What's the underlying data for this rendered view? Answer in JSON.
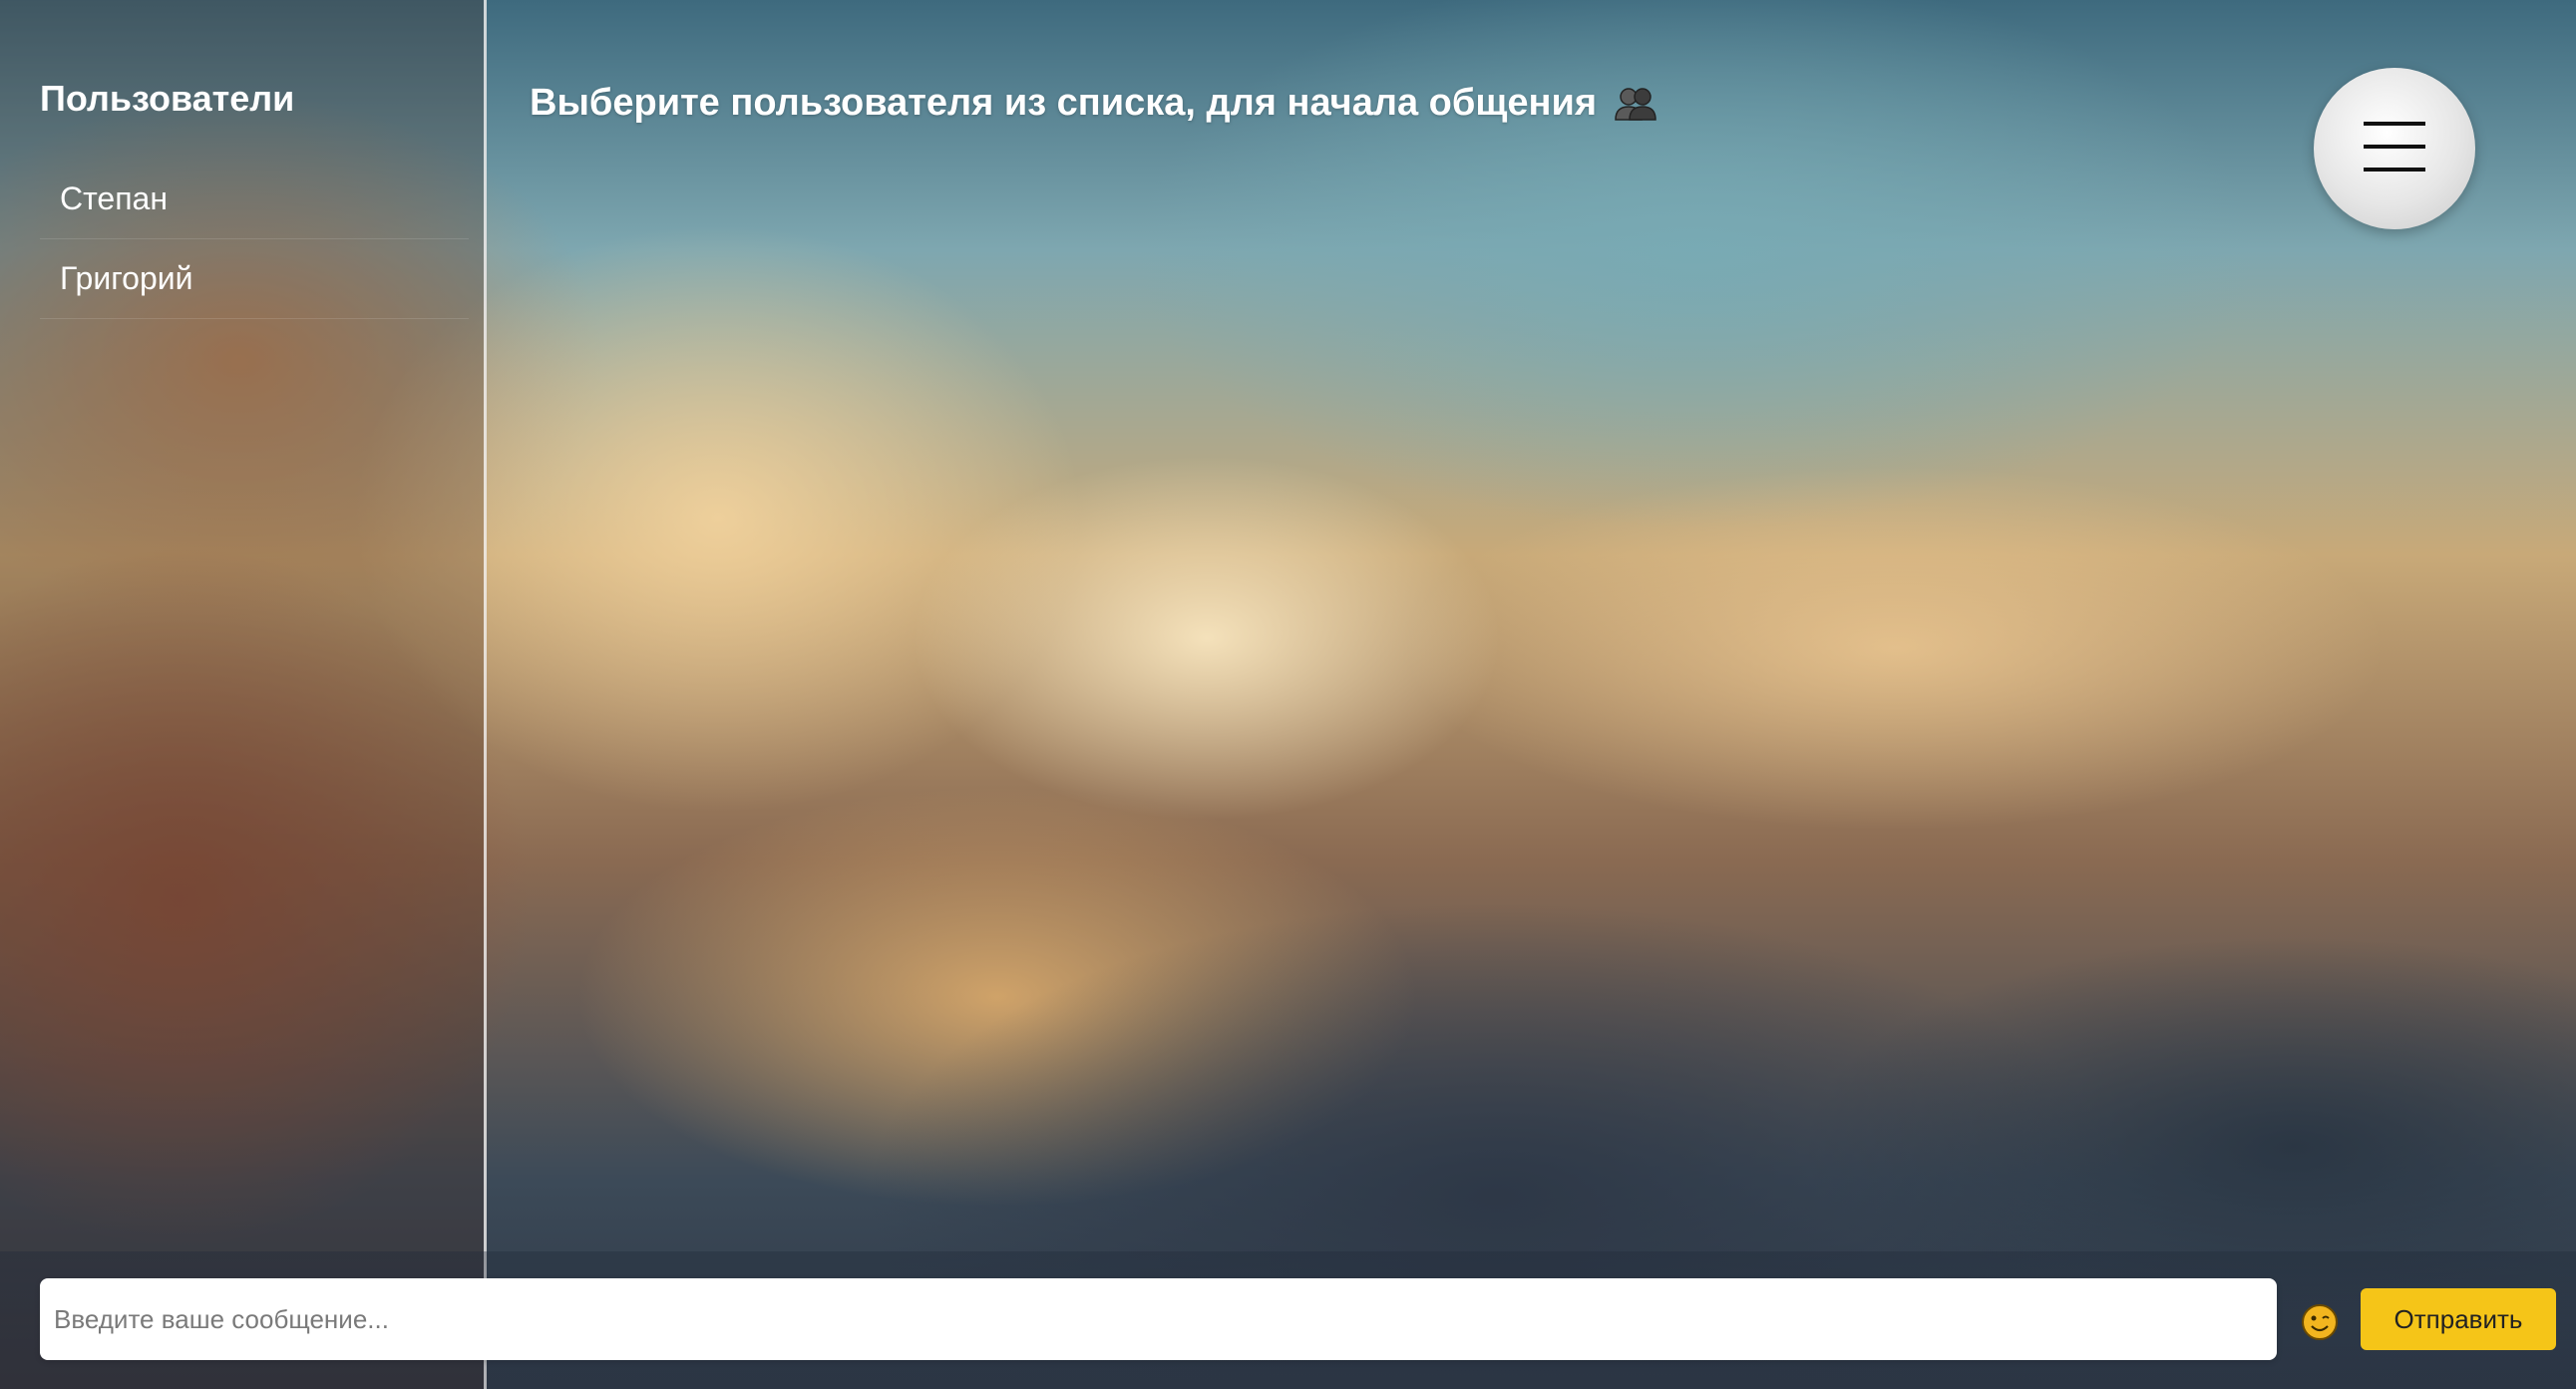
{
  "sidebar": {
    "title": "Пользователи",
    "users": [
      {
        "name": "Степан"
      },
      {
        "name": "Григорий"
      }
    ]
  },
  "header": {
    "title": "Выберите пользователя из списка, для начала общения",
    "icon": "people-icon"
  },
  "menu": {
    "icon": "hamburger-menu-icon"
  },
  "composer": {
    "placeholder": "Введите ваше сообщение...",
    "value": "",
    "emoji_icon": "smiley-icon",
    "send_label": "Отправить"
  },
  "colors": {
    "accent": "#f5c518",
    "text_light": "#ffffff"
  }
}
